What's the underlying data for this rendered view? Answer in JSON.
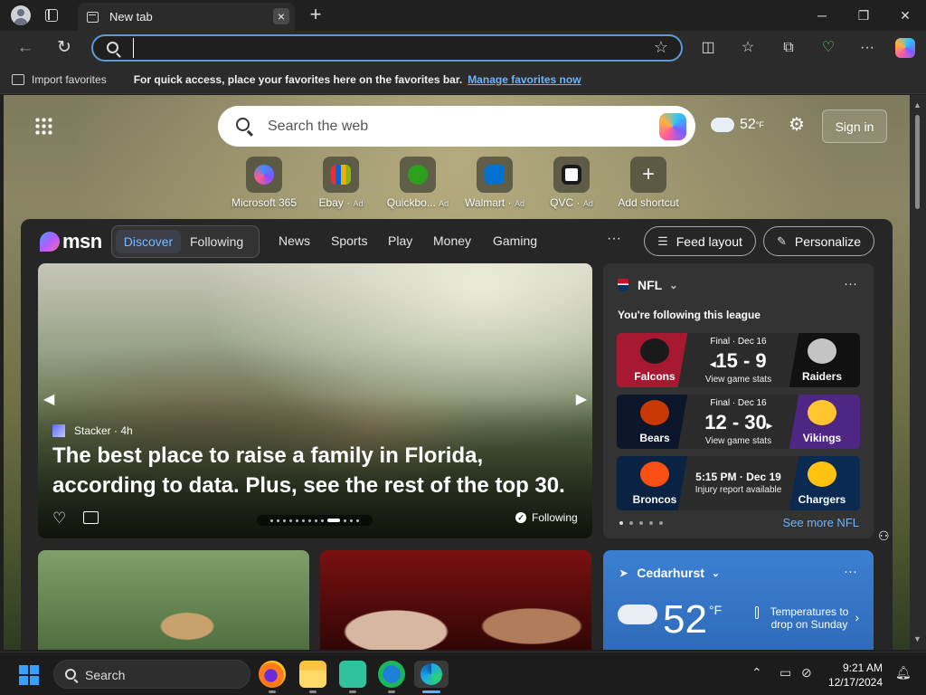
{
  "browser": {
    "tab_title": "New tab",
    "tab_close": "×",
    "new_tab": "+",
    "window_controls": {
      "minimize": "─",
      "restore": "❐",
      "close": "✕"
    },
    "address_value": "",
    "back_glyph": "←",
    "reload_glyph": "↻",
    "star_glyph": "☆",
    "toolbar_glyphs": {
      "split": "◫",
      "favorites": "☆",
      "collections": "⧉",
      "performance": "♡",
      "more": "···"
    }
  },
  "favorites_bar": {
    "import_label": "Import favorites",
    "hint": "For quick access, place your favorites here on the favorites bar.",
    "manage_link": "Manage favorites now"
  },
  "ntp": {
    "search_placeholder": "Search the web",
    "weather_temp": "52",
    "weather_unit": "°F",
    "gear_glyph": "⚙",
    "sign_in": "Sign in",
    "shortcuts": [
      {
        "label": "Microsoft 365",
        "ad": "",
        "icon": "microsoft-365-icon",
        "color": "#6b4dd6"
      },
      {
        "label": "Ebay",
        "ad": "Ad",
        "icon": "ebay-icon",
        "color": "#e53238"
      },
      {
        "label": "Quickbo...",
        "ad": "Ad",
        "icon": "quickbooks-icon",
        "color": "#2ca01c"
      },
      {
        "label": "Walmart",
        "ad": "Ad",
        "icon": "walmart-icon",
        "color": "#0071ce"
      },
      {
        "label": "QVC",
        "ad": "Ad",
        "icon": "qvc-icon",
        "color": "#ffffff"
      },
      {
        "label": "Add shortcut",
        "ad": "",
        "icon": "add-icon",
        "color": "#555555"
      }
    ]
  },
  "feed": {
    "brand": "msn",
    "tabs": {
      "active": "Discover",
      "other": "Following"
    },
    "nav": [
      "News",
      "Sports",
      "Play",
      "Money",
      "Gaming"
    ],
    "more": "···",
    "feed_layout": "Feed layout",
    "personalize": "Personalize",
    "hero": {
      "source": "Stacker · 4h",
      "title": "The best place to raise a family in Florida, according to data. Plus, see the rest of the top 30.",
      "following": "Following"
    },
    "nfl": {
      "title": "NFL",
      "subtitle": "You're following this league",
      "see_more": "See more NFL",
      "games": [
        {
          "status": "Final · Dec 16",
          "score": "15 - 9",
          "marker": "◂",
          "link": "View game stats",
          "home": "Falcons",
          "away": "Raiders",
          "home_color": "#a71930",
          "away_color": "#000000"
        },
        {
          "status": "Final · Dec 16",
          "score": "12 - 30",
          "marker": "▸",
          "link": "View game stats",
          "home": "Bears",
          "away": "Vikings",
          "home_color": "#0b162a",
          "away_color": "#4f2683"
        },
        {
          "status": "5:15 PM · Dec 19",
          "score": "",
          "marker": "",
          "link": "Injury report available",
          "home": "Broncos",
          "away": "Chargers",
          "home_color": "#fb4f14",
          "away_color": "#0080c6"
        }
      ]
    },
    "weather": {
      "location": "Cedarhurst",
      "temp": "52",
      "unit": "°F",
      "note": "Temperatures to drop on Sunday"
    }
  },
  "taskbar": {
    "search_label": "Search",
    "time": "9:21 AM",
    "date": "12/17/2024"
  }
}
